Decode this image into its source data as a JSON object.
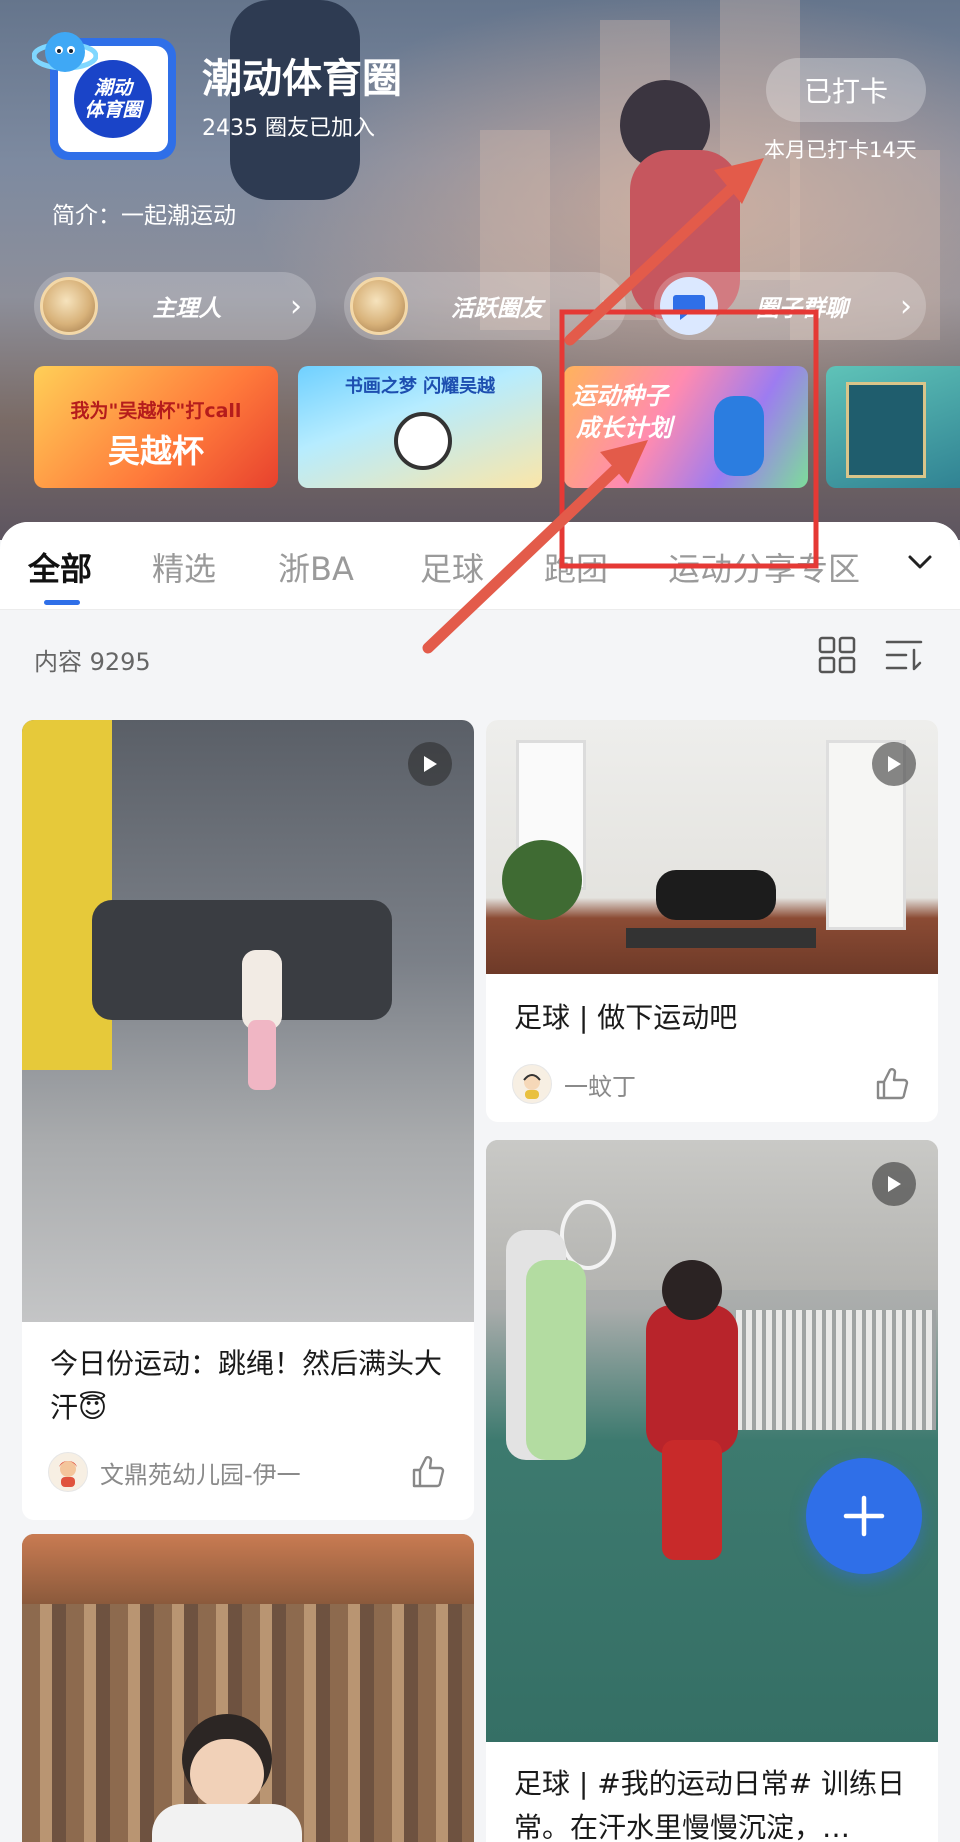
{
  "circle": {
    "name": "潮动体育圈",
    "members": "2435 圈友已加入",
    "intro": "简介：一起潮运动",
    "logo_text": "潮动\n体育圈",
    "checkin_label": "已打卡",
    "checkin_days": "本月已打卡14天"
  },
  "quick_links": [
    {
      "label": "主理人",
      "icon": "avatar-owner"
    },
    {
      "label": "活跃圈友",
      "icon": "avatar-active"
    },
    {
      "label": "圈子群聊",
      "icon": "chat-icon"
    }
  ],
  "banners": [
    {
      "text1": "我为\"吴越杯\"打call",
      "text2": "吴越杯"
    },
    {
      "text1": "书画之梦 闪耀吴越",
      "text2": ""
    },
    {
      "text1": "运动种子",
      "text2": "成长计划"
    },
    {
      "text1": "",
      "text2": ""
    }
  ],
  "tabs": [
    "全部",
    "精选",
    "浙BA",
    "足球",
    "跑团",
    "运动分享专区"
  ],
  "active_tab": "全部",
  "content_count": "内容 9295",
  "posts": [
    {
      "title": "今日份运动：跳绳！然后满头大汗😇",
      "author": "文鼎苑幼儿园-伊一",
      "has_video": true
    },
    {
      "title": "足球 | 做下运动吧",
      "author": "一蚊丁",
      "has_video": true
    },
    {
      "title": "足球 | #我的运动日常# 训练日常。在汗水里慢慢沉淀，…",
      "author": "",
      "has_video": true
    },
    {
      "title": "",
      "author": "",
      "has_video": false
    }
  ],
  "colors": {
    "accent": "#2f6fe8",
    "annotation": "#e53935"
  }
}
